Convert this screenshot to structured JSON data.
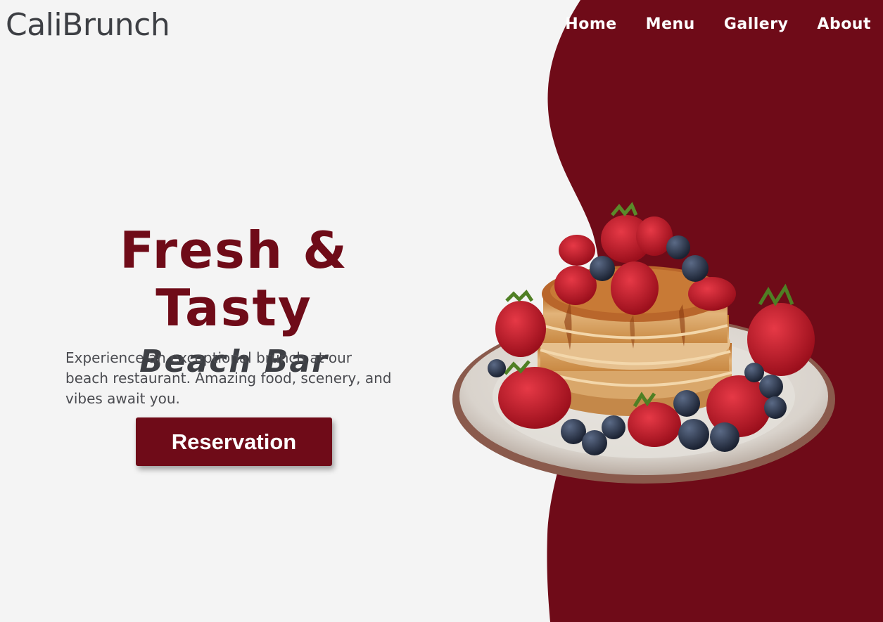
{
  "brand": {
    "logo": "CaliBrunch",
    "accent_color": "#6f0b18",
    "background_color": "#f4f4f4"
  },
  "nav": {
    "items": [
      {
        "label": "Home"
      },
      {
        "label": "Menu"
      },
      {
        "label": "Gallery"
      },
      {
        "label": "About"
      }
    ]
  },
  "hero": {
    "headline": "Fresh & Tasty",
    "subheadline": "Beach Bar",
    "description": "Experience an exceptional brunch at our beach restaurant. Amazing food, scenery, and vibes await you.",
    "cta_label": "Reservation"
  },
  "image": {
    "subject": "pancake-stack-with-berries-on-plate"
  }
}
